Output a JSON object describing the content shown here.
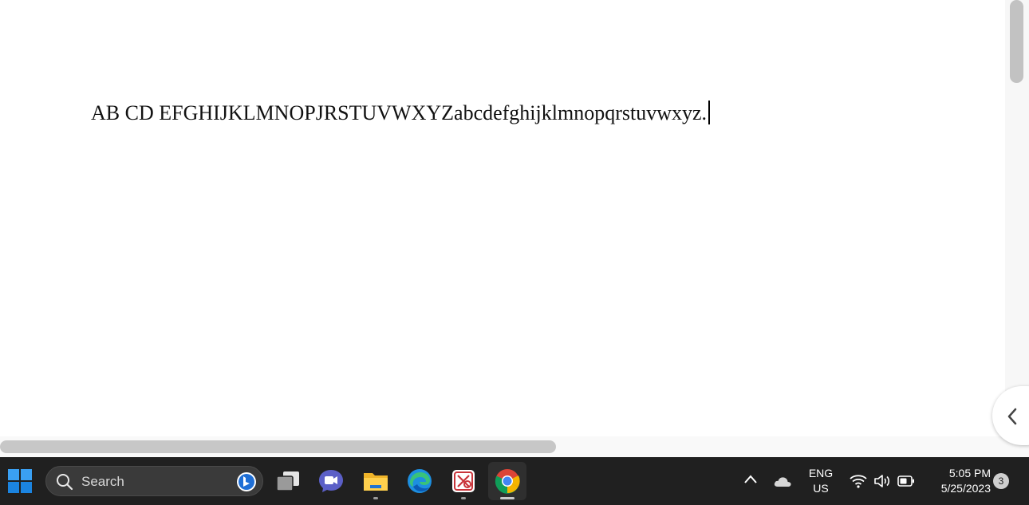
{
  "document": {
    "text": "AB CD EFGHIJKLMNOPJRSTUVWXYZabcdefghijklmnopqrstuvwxyz."
  },
  "taskbar": {
    "search_placeholder": "Search",
    "apps": [
      {
        "name": "start",
        "icon": "windows-start-icon"
      },
      {
        "name": "task-view",
        "icon": "task-view-icon"
      },
      {
        "name": "teams-chat",
        "icon": "teams-chat-icon"
      },
      {
        "name": "file-explorer",
        "icon": "folder-icon"
      },
      {
        "name": "edge",
        "icon": "edge-browser-icon"
      },
      {
        "name": "snipping-tool",
        "icon": "snipping-tool-icon"
      },
      {
        "name": "chrome",
        "icon": "chrome-browser-icon"
      }
    ],
    "tray": {
      "language_line1": "ENG",
      "language_line2": "US",
      "time": "5:05 PM",
      "date": "5/25/2023",
      "notification_count": "3"
    }
  },
  "colors": {
    "taskbar_bg": "#202020",
    "accent_blue": "#0078d4"
  }
}
